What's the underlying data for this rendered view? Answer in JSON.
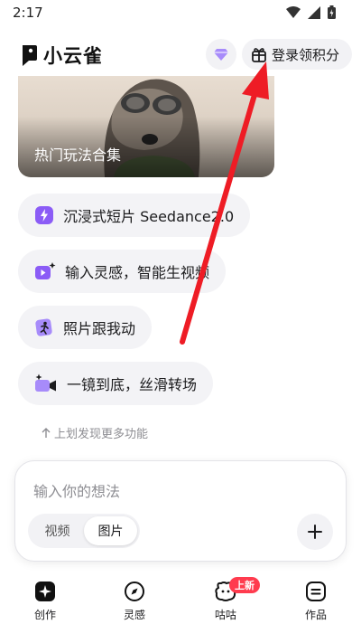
{
  "status_bar": {
    "time": "2:17"
  },
  "header": {
    "app_name": "小云雀",
    "login_label": "登录领积分"
  },
  "banner": {
    "caption": "热门玩法合集"
  },
  "features": [
    {
      "label": "沉浸式短片 Seedance2.0"
    },
    {
      "label": "输入灵感，智能生视频"
    },
    {
      "label": "照片跟我动"
    },
    {
      "label": "一镜到底，丝滑转场"
    }
  ],
  "swipe_hint": "上划发现更多功能",
  "composer": {
    "placeholder": "输入你的想法",
    "modes": [
      "视频",
      "图片"
    ],
    "active_mode": "图片"
  },
  "bottom_nav": {
    "items": [
      {
        "label": "创作"
      },
      {
        "label": "灵感"
      },
      {
        "label": "咕咕",
        "badge": "上新"
      },
      {
        "label": "作品"
      }
    ]
  },
  "colors": {
    "accent_purple": "#8b5cf6",
    "badge_red": "#ff3b4e",
    "annotation_arrow": "#ee1c25"
  }
}
